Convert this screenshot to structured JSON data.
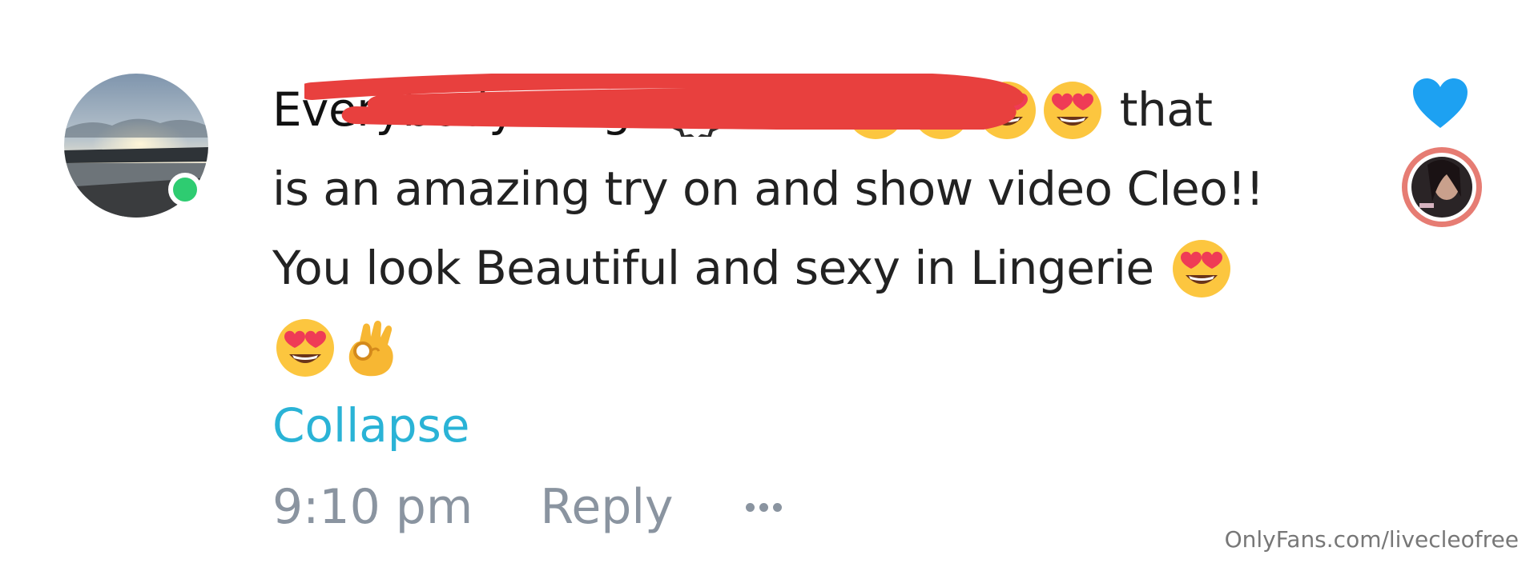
{
  "comment": {
    "username": "Everybodyoungel",
    "line1_text1": "Wow",
    "line1_text2": "that",
    "line2": "is an amazing try on and show video Cleo!!",
    "line3": "You look Beautiful and sexy in Lingerie",
    "collapse_label": "Collapse",
    "time": "9:10 pm",
    "reply_label": "Reply"
  },
  "icons": {
    "verified": "verified-badge-icon",
    "heart_eyes": "heart-eyes-emoji",
    "ok_hand": "ok-hand-emoji",
    "like": "heart-icon",
    "more": "more-dots-icon"
  },
  "colors": {
    "link": "#2ab3d6",
    "like_heart": "#1da1f2",
    "online": "#2ecc71",
    "meta": "#8a94a0",
    "redaction": "#e8403e"
  },
  "watermark": "OnlyFans.com/livecleofree"
}
